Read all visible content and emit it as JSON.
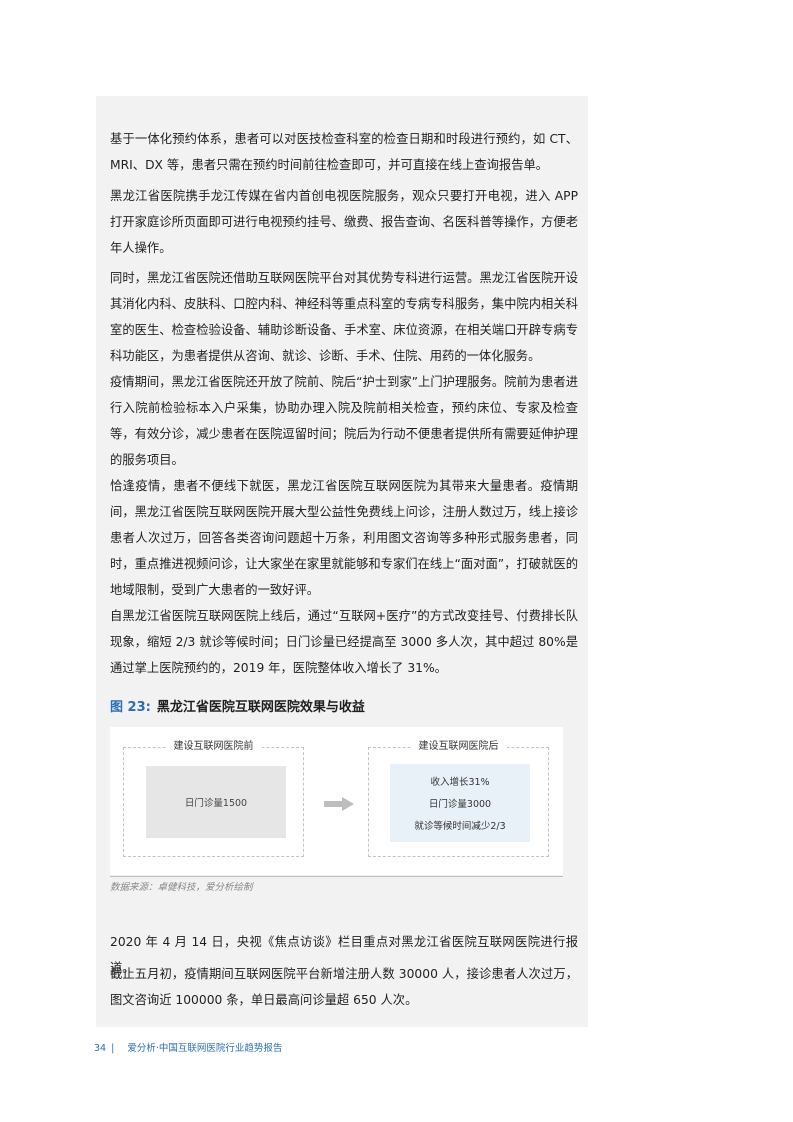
{
  "paragraphs": [
    "基于一体化预约体系，患者可以对医技检查科室的检查日期和时段进行预约，如 CT、MRI、DX 等，患者只需在预约时间前往检查即可，并可直接在线上查询报告单。",
    "黑龙江省医院携手龙江传媒在省内首创电视医院服务，观众只要打开电视，进入 APP 打开家庭诊所页面即可进行电视预约挂号、缴费、报告查询、名医科普等操作，方便老年人操作。",
    "同时，黑龙江省医院还借助互联网医院平台对其优势专科进行运营。黑龙江省医院开设其消化内科、皮肤科、口腔内科、神经科等重点科室的专病专科服务，集中院内相关科室的医生、检查检验设备、辅助诊断设备、手术室、床位资源，在相关端口开辟专病专科功能区，为患者提供从咨询、就诊、诊断、手术、住院、用药的一体化服务。",
    "疫情期间，黑龙江省医院还开放了院前、院后“护士到家”上门护理服务。院前为患者进行入院前检验标本入户采集，协助办理入院及院前相关检查，预约床位、专家及检查等，有效分诊，减少患者在医院逗留时间；院后为行动不便患者提供所有需要延伸护理的服务项目。",
    "恰逢疫情，患者不便线下就医，黑龙江省医院互联网医院为其带来大量患者。疫情期间，黑龙江省医院互联网医院开展大型公益性免费线上问诊，注册人数过万，线上接诊患者人次过万，回答各类咨询问题超十万条，利用图文咨询等多种形式服务患者，同时，重点推进视频问诊，让大家坐在家里就能够和专家们在线上“面对面”，打破就医的地域限制，受到广大患者的一致好评。",
    "自黑龙江省医院互联网医院上线后，通过“互联网+医疗”的方式改变挂号、付费排长队现象，缩短 2/3 就诊等候时间；日门诊量已经提高至 3000 多人次，其中超过 80%是通过掌上医院预约的，2019 年，医院整体收入增长了 31%。"
  ],
  "figure": {
    "number": "图 23:",
    "title": "黑龙江省医院互联网医院效果与收益",
    "before_label": "建设互联网医院前",
    "before_text": "日门诊量1500",
    "after_label": "建设互联网医院后",
    "after_items": [
      "收入增长31%",
      "日门诊量3000",
      "就诊等候时间减少2/3"
    ],
    "source": "数据来源：卓健科技，爱分析绘制",
    "arrow_icon": "right-arrow-icon"
  },
  "after_paragraphs": [
    "2020 年 4 月 14 日，央视《焦点访谈》栏目重点对黑龙江省医院互联网医院进行报道。",
    "截止五月初，疫情期间互联网医院平台新增注册人数 30000 人，接诊患者人次过万，图文咨询近 100000 条，单日最高问诊量超 650 人次。"
  ],
  "footer": {
    "page_number": "34",
    "separator": "|",
    "report_title": "爱分析·中国互联网医院行业趋势报告"
  },
  "colors": {
    "panel_bg": "#f2f2f2",
    "accent_blue": "#2a6db5",
    "after_box_bg": "#e8f0f8"
  }
}
